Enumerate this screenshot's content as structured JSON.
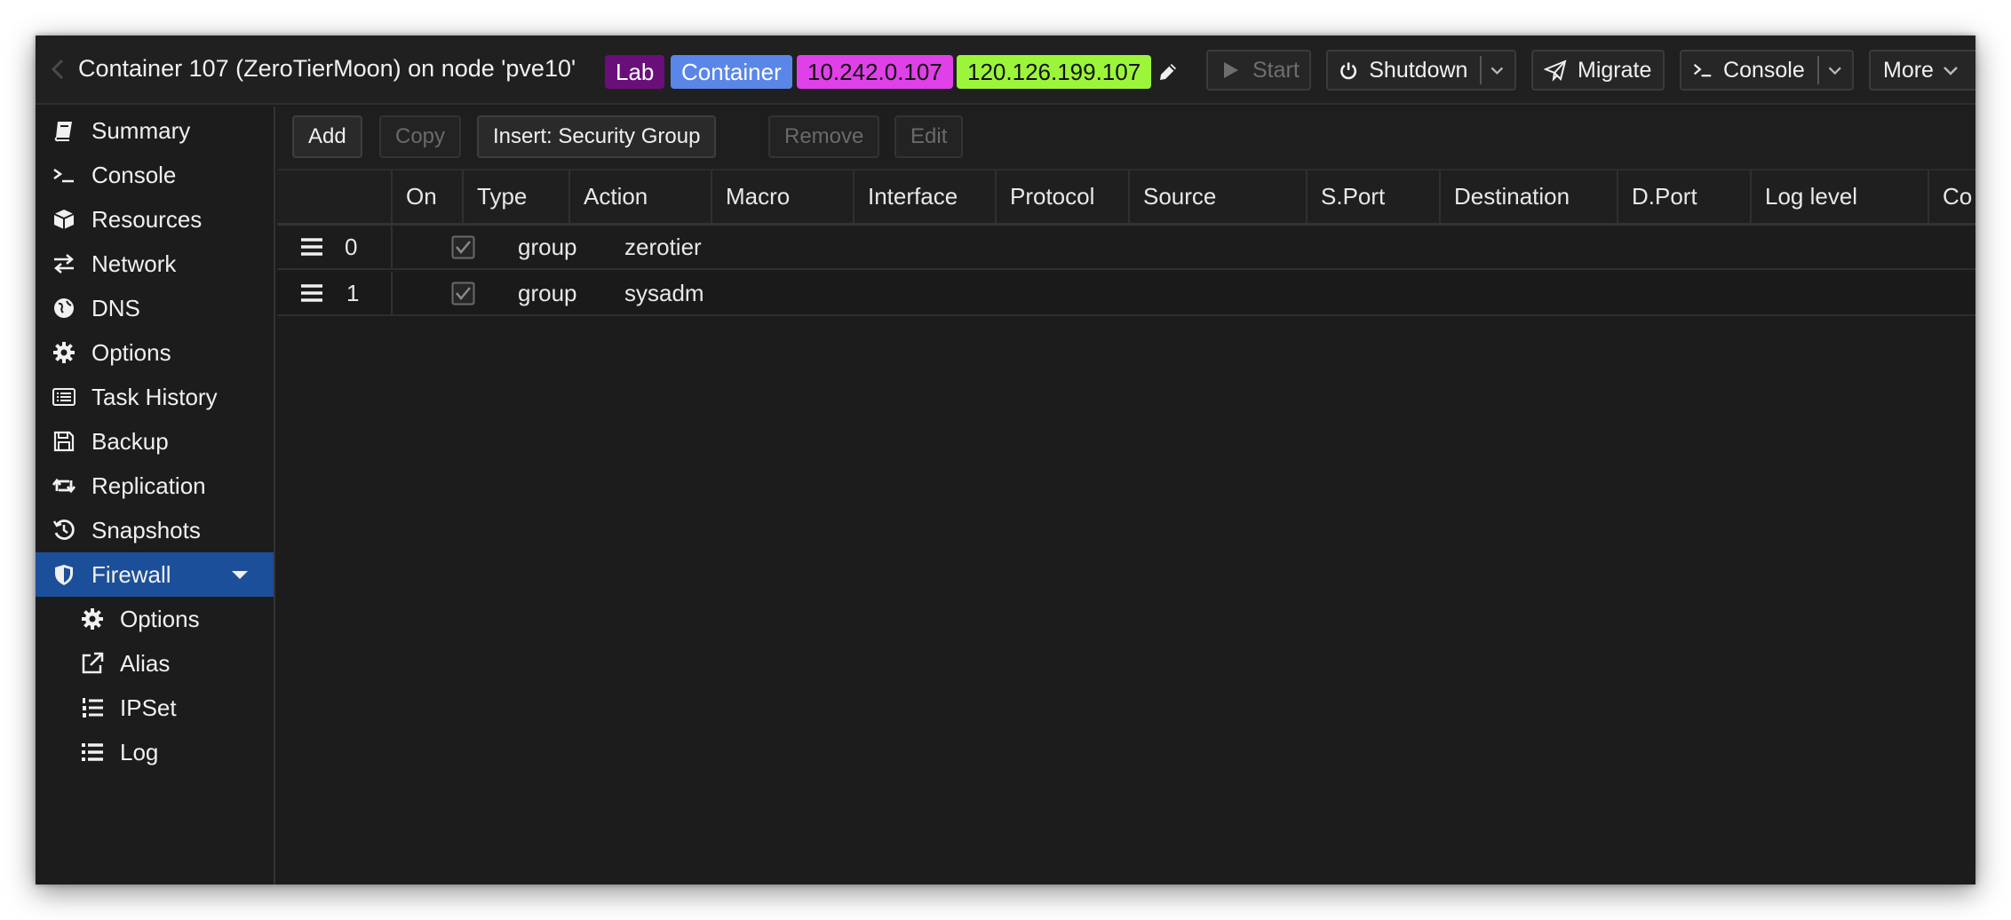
{
  "header": {
    "title": "Container 107 (ZeroTierMoon) on node 'pve10'",
    "tags": [
      {
        "label": "Lab",
        "color": "#6a0f7a"
      },
      {
        "label": "Container",
        "color": "#5a86e8"
      },
      {
        "label": "10.242.0.107",
        "color": "#e040e8"
      },
      {
        "label": "120.126.199.107",
        "color": "#9cf53a"
      }
    ],
    "buttons": {
      "start": "Start",
      "shutdown": "Shutdown",
      "migrate": "Migrate",
      "console": "Console",
      "more": "More"
    }
  },
  "sidebar": {
    "items": [
      {
        "label": "Summary",
        "icon": "book-icon"
      },
      {
        "label": "Console",
        "icon": "terminal-icon"
      },
      {
        "label": "Resources",
        "icon": "cube-icon"
      },
      {
        "label": "Network",
        "icon": "exchange-icon"
      },
      {
        "label": "DNS",
        "icon": "globe-icon"
      },
      {
        "label": "Options",
        "icon": "gear-icon"
      },
      {
        "label": "Task History",
        "icon": "list-alt-icon"
      },
      {
        "label": "Backup",
        "icon": "floppy-icon"
      },
      {
        "label": "Replication",
        "icon": "retweet-icon"
      },
      {
        "label": "Snapshots",
        "icon": "history-icon"
      },
      {
        "label": "Firewall",
        "icon": "shield-icon",
        "active": true
      },
      {
        "label": "Options",
        "icon": "gear-icon"
      },
      {
        "label": "Alias",
        "icon": "external-link-icon"
      },
      {
        "label": "IPSet",
        "icon": "list-ol-icon"
      },
      {
        "label": "Log",
        "icon": "list-icon"
      }
    ],
    "active_color": "#1c4f99"
  },
  "toolbar": {
    "add": "Add",
    "copy": "Copy",
    "insert": "Insert: Security Group",
    "remove": "Remove",
    "edit": "Edit"
  },
  "grid": {
    "columns": [
      "On",
      "Type",
      "Action",
      "Macro",
      "Interface",
      "Protocol",
      "Source",
      "S.Port",
      "Destination",
      "D.Port",
      "Log level",
      "Co"
    ],
    "rows": [
      {
        "index": "0",
        "on": true,
        "type": "group",
        "action": "zerotier"
      },
      {
        "index": "1",
        "on": true,
        "type": "group",
        "action": "sysadm"
      }
    ]
  }
}
